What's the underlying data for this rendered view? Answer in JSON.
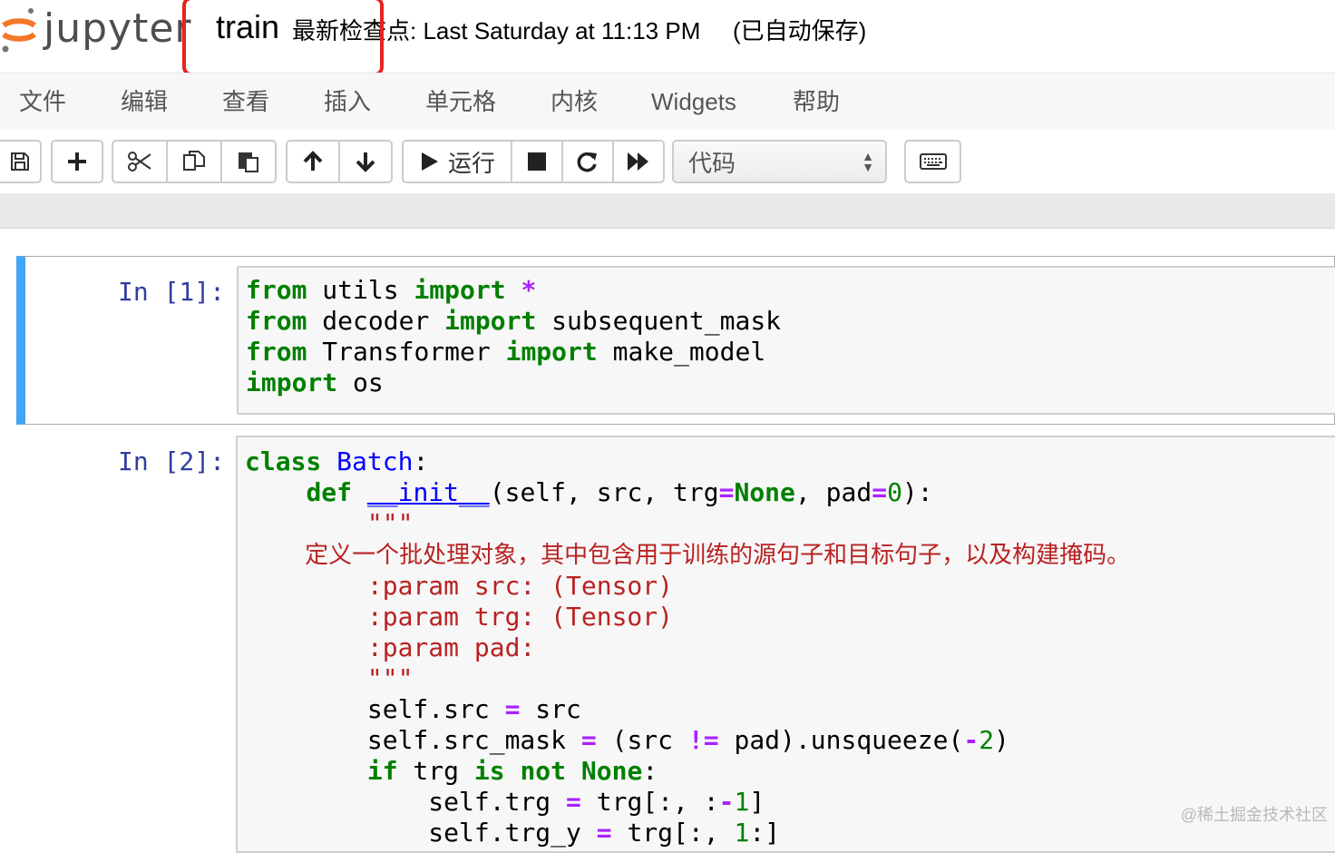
{
  "header": {
    "logo_text": "jupyter",
    "notebook_name": "train",
    "checkpoint_text": "最新检查点: Last Saturday at 11:13 PM",
    "autosave_text": "(已自动保存)"
  },
  "menu": {
    "items": [
      "文件",
      "编辑",
      "查看",
      "插入",
      "单元格",
      "内核",
      "Widgets",
      "帮助"
    ]
  },
  "toolbar": {
    "run_label": "运行",
    "cell_type_value": "代码"
  },
  "cells": [
    {
      "prompt": "In [1]:",
      "lines": [
        [
          "from utils import *"
        ],
        [
          "from decoder import subsequent_mask"
        ],
        [
          "from Transformer import make_model"
        ],
        [
          "import os"
        ]
      ]
    },
    {
      "prompt": "In [2]:",
      "lines": [
        "class Batch:",
        "    def __init__(self, src, trg=None, pad=0):",
        "        \"\"\"",
        "        定义一个批处理对象，其中包含用于训练的源句子和目标句子，以及构建掩码。",
        "        :param src: (Tensor)",
        "        :param trg: (Tensor)",
        "        :param pad:",
        "        \"\"\"",
        "        self.src = src",
        "        self.src_mask = (src != pad).unsqueeze(-2)",
        "        if trg is not None:",
        "            self.trg = trg[:, :-1]",
        "            self.trg_y = trg[:, 1:]"
      ]
    }
  ],
  "watermark": "@稀土掘金技术社区",
  "colors": {
    "selected_cell_bar": "#42a5f5",
    "prompt": "#303f9f",
    "keyword": "#008000",
    "string": "#ba2121",
    "highlight_box": "#e8231f"
  }
}
